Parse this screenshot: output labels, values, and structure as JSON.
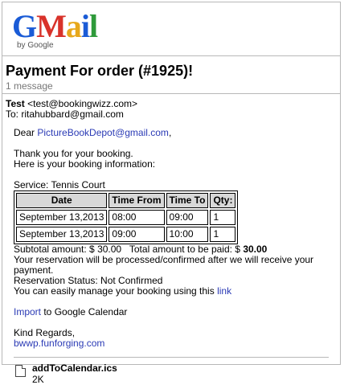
{
  "logo": {
    "word": "Gmail",
    "sub": "by Google"
  },
  "subject": "Payment For order (#1925)!",
  "message_count": "1 message",
  "header": {
    "from_name": "Test",
    "from_email": "<test@bookingwizz.com>",
    "to_line": "To: ritahubbard@gmail.com"
  },
  "body": {
    "greeting_prefix": "Dear ",
    "greeting_email": "PictureBookDepot@gmail.com",
    "greeting_suffix": ",",
    "thanks": "Thank you for your booking.",
    "here_info": "Here is your booking information:",
    "service": "Service: Tennis Court",
    "table": {
      "headers": [
        "Date",
        "Time From",
        "Time To",
        "Qty:"
      ],
      "rows": [
        [
          "September 13,2013",
          "08:00",
          "09:00",
          "1"
        ],
        [
          "September 13,2013",
          "09:00",
          "10:00",
          "1"
        ]
      ]
    },
    "subtotal_prefix": "Subtotal amount: $ 30.00   Total amount to be paid: $ ",
    "subtotal_bold": "30.00",
    "processed": "Your reservation will be processed/confirmed after we will receive your payment.",
    "status": "Reservation Status: Not Confirmed",
    "manage_prefix": "You can easily manage your booking using this ",
    "manage_link": "link",
    "import_link": "Import",
    "import_suffix": " to Google Calendar",
    "regards": "Kind Regards,",
    "site_link": "bwwp.funforging.com"
  },
  "attachment": {
    "name": "addToCalendar.ics",
    "size": "2K"
  }
}
